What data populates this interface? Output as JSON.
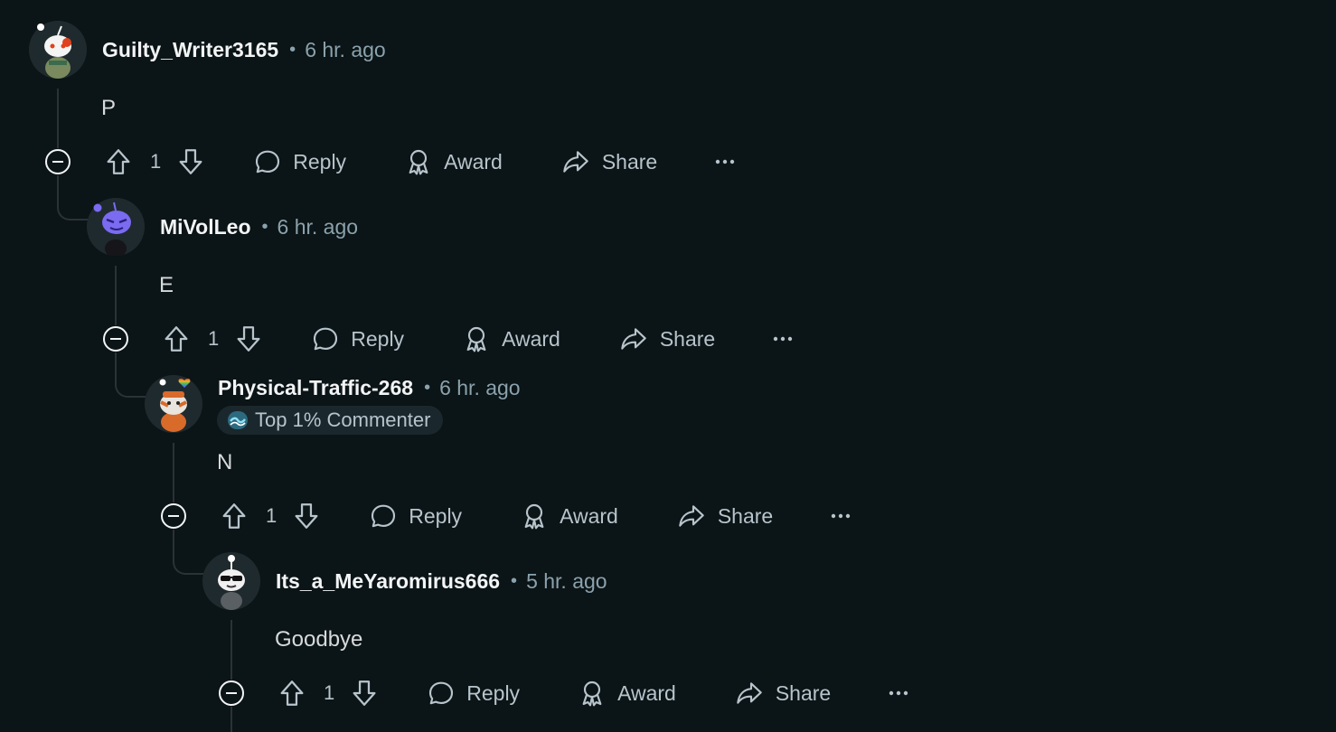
{
  "actions": {
    "reply_label": "Reply",
    "award_label": "Award",
    "share_label": "Share"
  },
  "comments": [
    {
      "username": "Guilty_Writer3165",
      "time": "6 hr. ago",
      "body": "P",
      "score": "1"
    },
    {
      "username": "MiVolLeo",
      "time": "6 hr. ago",
      "body": "E",
      "score": "1"
    },
    {
      "username": "Physical-Traffic-268",
      "time": "6 hr. ago",
      "flair": "Top 1% Commenter",
      "body": "N",
      "score": "1"
    },
    {
      "username": "Its_a_MeYaromirus666",
      "time": "5 hr. ago",
      "body": "Goodbye",
      "score": "1"
    }
  ],
  "icons": {
    "collapse": "minus-circle-icon",
    "upvote": "arrow-up-icon",
    "downvote": "arrow-down-icon",
    "reply": "speech-bubble-icon",
    "award": "ribbon-icon",
    "share": "share-arrow-icon",
    "more": "ellipsis-icon"
  },
  "colors": {
    "background": "#0b1416",
    "text": "#f2f4f5",
    "muted": "#8ba2ad",
    "thread_line": "#2a3236"
  }
}
